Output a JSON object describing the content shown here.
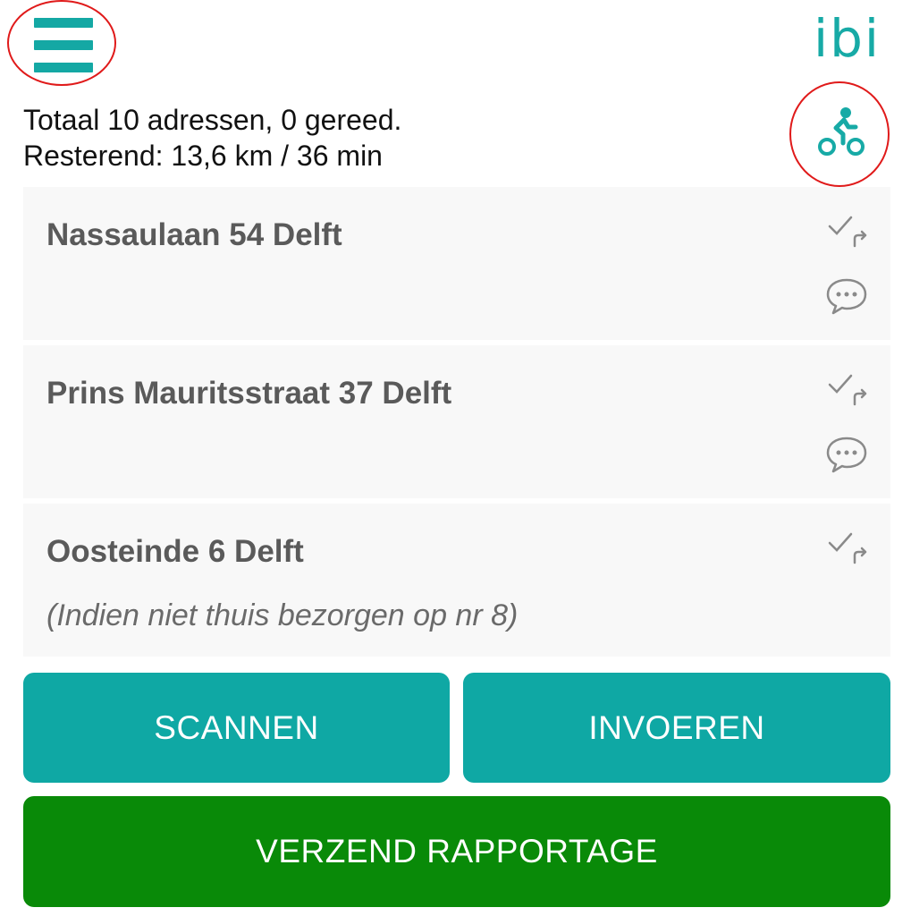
{
  "header": {
    "logo_text": "ibi",
    "menu_icon": "hamburger-menu-icon",
    "mode_icon": "bicycle-icon"
  },
  "summary": {
    "line1": "Totaal 10 adressen, 0 gereed.",
    "line2": "Resterend: 13,6 km / 36 min"
  },
  "addresses": [
    {
      "address": "Nassaulaan 54 Delft",
      "note": "",
      "icons": [
        "check-route-icon",
        "chat-bubble-icon"
      ]
    },
    {
      "address": "Prins Mauritsstraat 37 Delft",
      "note": "",
      "icons": [
        "check-route-icon",
        "chat-bubble-icon"
      ]
    },
    {
      "address": "Oosteinde 6 Delft",
      "note": "(Indien niet thuis bezorgen op nr 8)",
      "icons": [
        "check-route-icon"
      ]
    }
  ],
  "buttons": {
    "scan_label": "SCANNEN",
    "enter_label": "INVOEREN",
    "send_label": "VERZEND RAPPORTAGE"
  },
  "colors": {
    "teal": "#0fa8a4",
    "green": "#098a08",
    "highlight_circle": "#e01a1a",
    "row_background": "#f8f8f8"
  }
}
